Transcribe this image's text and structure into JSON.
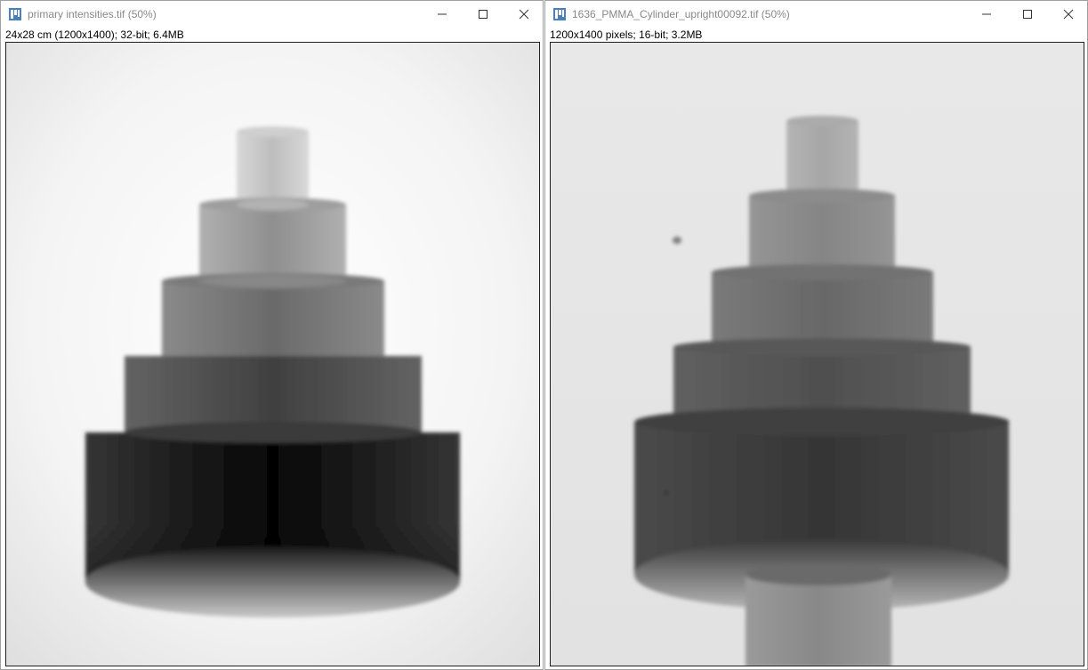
{
  "windows": [
    {
      "id": "left",
      "title": "primary intensities.tif (50%)",
      "info": "24x28 cm (1200x1400); 32-bit; 6.4MB"
    },
    {
      "id": "right",
      "title": "1636_PMMA_Cylinder_upright00092.tif (50%)",
      "info": "1200x1400 pixels; 16-bit; 3.2MB"
    }
  ],
  "icons": {
    "app": "imagej-icon",
    "minimize": "minimize-icon",
    "maximize": "maximize-icon",
    "close": "close-icon"
  },
  "colors": {
    "title_text": "#888888",
    "app_icon": "#4a7fbf",
    "frame_border": "#202020"
  }
}
